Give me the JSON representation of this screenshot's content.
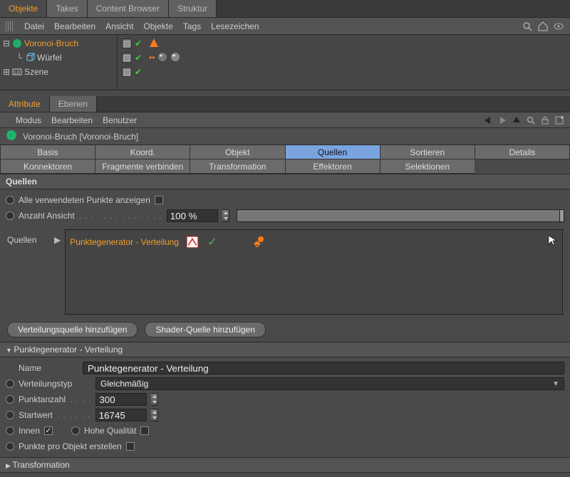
{
  "objects_panel": {
    "tabs": [
      "Objekte",
      "Takes",
      "Content Browser",
      "Struktur"
    ],
    "active_tab": 0,
    "menu": [
      "Datei",
      "Bearbeiten",
      "Ansicht",
      "Objekte",
      "Tags",
      "Lesezeichen"
    ],
    "tree": [
      {
        "label": "Voronoi-Bruch",
        "indent": 0,
        "selected": true,
        "icon": "voronoi"
      },
      {
        "label": "Würfel",
        "indent": 1,
        "selected": false,
        "icon": "cube"
      },
      {
        "label": "Szene",
        "indent": 0,
        "selected": false,
        "icon": "scene"
      }
    ]
  },
  "attributes_panel": {
    "tabs": [
      "Attribute",
      "Ebenen"
    ],
    "active_tab": 0,
    "menu": [
      "Modus",
      "Bearbeiten",
      "Benutzer"
    ],
    "object_header": "Voronoi-Bruch [Voronoi-Bruch]",
    "attr_tabs": {
      "row1": [
        "Basis",
        "Koord.",
        "Objekt",
        "Quellen",
        "Sortieren",
        "Details"
      ],
      "row2": [
        "Konnektoren",
        "Fragmente verbinden",
        "Transformation",
        "Effektoren",
        "Selektionen",
        ""
      ],
      "active": "Quellen"
    },
    "sources_section": {
      "header": "Quellen",
      "show_all_points_label": "Alle verwendeten Punkte anzeigen",
      "show_all_points_checked": false,
      "count_view_label": "Anzahl Ansicht",
      "count_view_value": "100 %",
      "list_label": "Quellen",
      "entry_name": "Punktegenerator - Verteilung",
      "add_dist_button": "Verteilungsquelle hinzufügen",
      "add_shader_button": "Shader-Quelle hinzufügen"
    },
    "point_gen": {
      "header": "Punktegenerator - Verteilung",
      "name_label": "Name",
      "name_value": "Punktegenerator - Verteilung",
      "dist_type_label": "Verteilungstyp",
      "dist_type_value": "Gleichmäßig",
      "point_count_label": "Punktanzahl",
      "point_count_value": "300",
      "seed_label": "Startwert",
      "seed_value": "16745",
      "inner_label": "Innen",
      "inner_checked": true,
      "high_quality_label": "Hohe Qualität",
      "high_quality_checked": false,
      "points_per_object_label": "Punkte pro Objekt erstellen",
      "points_per_object_checked": false,
      "transformation_header": "Transformation"
    }
  }
}
